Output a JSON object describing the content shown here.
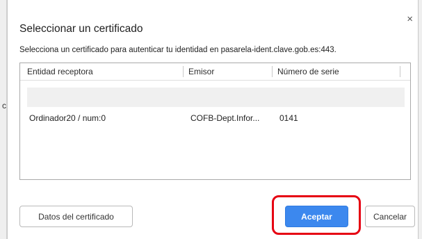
{
  "dialog": {
    "title": "Seleccionar un certificado",
    "subtitle": "Selecciona un certificado para autenticar tu identidad en pasarela-ident.clave.gob.es:443.",
    "close_glyph": "×"
  },
  "table": {
    "columns": [
      "Entidad receptora",
      "Emisor",
      "Número de serie"
    ],
    "rows": [
      {
        "subject": "Ordinador20 / num:0",
        "issuer": "COFB-Dept.Infor...",
        "serial": "0141"
      }
    ]
  },
  "buttons": {
    "details": "Datos del certificado",
    "accept": "Aceptar",
    "cancel": "Cancelar"
  },
  "background_glyph": "c",
  "colors": {
    "accent": "#3c88ee",
    "highlight": "#e60012"
  },
  "icons": {
    "close": "close-icon"
  }
}
